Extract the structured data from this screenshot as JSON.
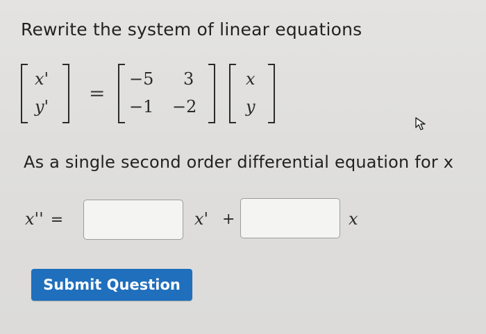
{
  "question": {
    "prompt": "Rewrite the system of linear equations",
    "system": {
      "lhs_vector": [
        "x'",
        "y'"
      ],
      "equals": "=",
      "matrix": [
        [
          "−5",
          "3"
        ],
        [
          "−1",
          "−2"
        ]
      ],
      "rhs_vector": [
        "x",
        "y"
      ]
    },
    "subprompt": "As a single second order differential equation for x"
  },
  "answer": {
    "lhs": "x''",
    "equals": "=",
    "input1": {
      "value": "",
      "placeholder": ""
    },
    "coef1_var": "x'",
    "plus": "+",
    "input2": {
      "value": "",
      "placeholder": ""
    },
    "coef2_var": "x"
  },
  "actions": {
    "submit_label": "Submit Question"
  },
  "colors": {
    "submit_button": "#1f6fbd",
    "background": "#e0dfdd"
  },
  "icons": {
    "cursor": "mouse-pointer-icon"
  }
}
